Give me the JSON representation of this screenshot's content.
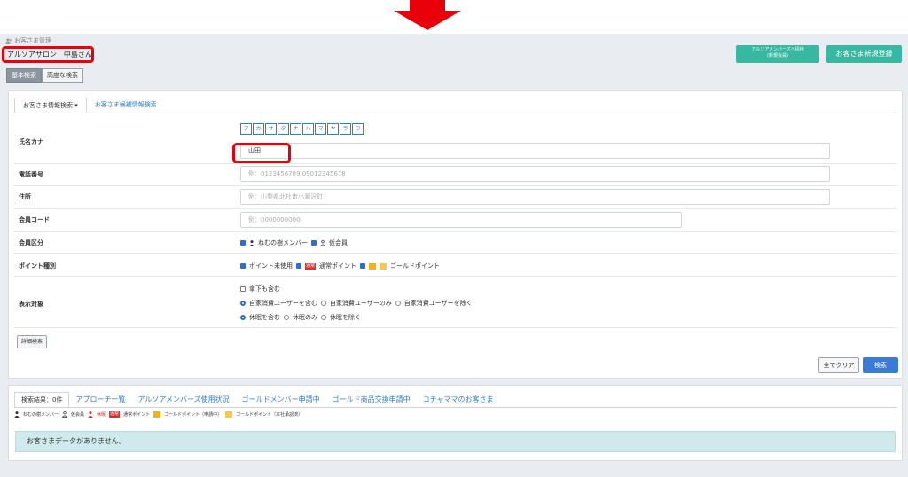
{
  "colors": {
    "accent": "#36b9a0",
    "primary": "#3a7bd5",
    "link": "#2b7fd6",
    "highlight": "#e8000b",
    "info_bg": "#cfeaec"
  },
  "breadcrumb": "お客さま管理",
  "salon_name": "アルソアサロン　中島さん",
  "mode_tabs": {
    "basic": "基本検索",
    "advanced": "高度な検索"
  },
  "header_buttons": {
    "members_line1": "アルソアメンバーズへ招待",
    "members_line2": "(新規会員)",
    "new_customer": "お客さま新規登録"
  },
  "search_tabs": {
    "info": "お客さま情報検索 ▾",
    "kana": "お客さま候補情報検索"
  },
  "kana_buttons": [
    "ア",
    "カ",
    "サ",
    "タ",
    "ナ",
    "ハ",
    "マ",
    "ヤ",
    "ラ",
    "ワ"
  ],
  "form": {
    "name_kana": {
      "label": "氏名カナ",
      "value": "山田"
    },
    "phone": {
      "label": "電話番号",
      "placeholder": "例：0123456789,09012345678"
    },
    "address": {
      "label": "住所",
      "placeholder": "例：山梨県北杜市小淵沢町"
    },
    "member_code": {
      "label": "会員コード",
      "placeholder": "例：0000000000"
    },
    "member_type": {
      "label": "会員区分",
      "opt1": "ねむの樹メンバー",
      "opt2": "仮会員"
    },
    "point_type": {
      "label": "ポイント種別",
      "opt1": "ポイント未使用",
      "badge": "通常",
      "opt2": "通常ポイント",
      "opt3": "ゴールドポイント"
    },
    "display": {
      "label": "表示対象",
      "sub": "傘下も含む",
      "r1a": "自家消費ユーザーを含む",
      "r1b": "自家消費ユーザーのみ",
      "r1c": "自家消費ユーザーを除く",
      "r2a": "休眠を含む",
      "r2b": "休眠のみ",
      "r2c": "休眠を除く"
    }
  },
  "buttons": {
    "detail": "詳細検索",
    "clear": "全てクリア",
    "search": "検索"
  },
  "result_tabs": [
    "検索結果：0件",
    "アプローチ一覧",
    "アルソアメンバーズ使用状況",
    "ゴールドメンバー申請中",
    "ゴールド商品交換申請中",
    "コチャママのお客さま"
  ],
  "legend": {
    "member": "ねむの樹メンバー",
    "provisional": "仮会員",
    "dormant": "休眠",
    "badge": "通常",
    "normal": "通常ポイント",
    "gold_pending": "ゴールドポイント（申請中）",
    "gold_approved": "ゴールドポイント（本社承認済）"
  },
  "empty_message": "お客さまデータがありません。"
}
